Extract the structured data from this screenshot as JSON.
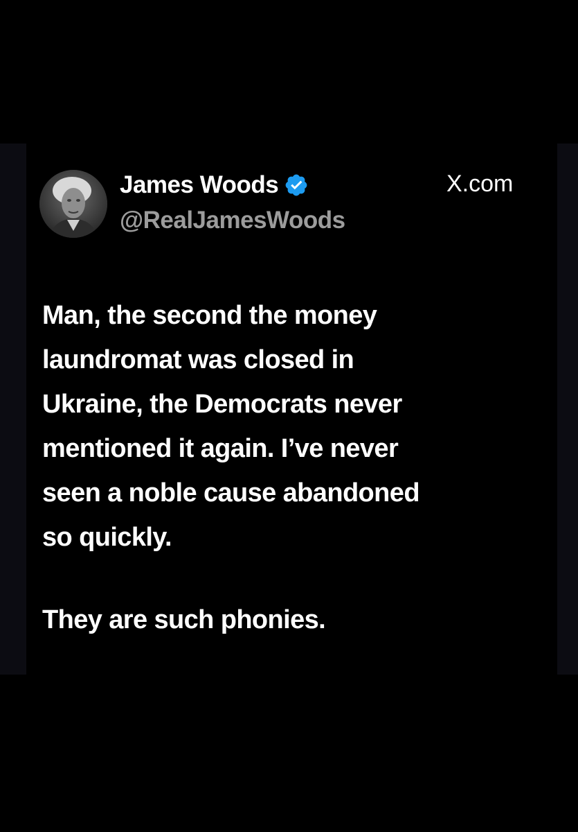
{
  "post": {
    "author_name": "James Woods",
    "author_handle": "@RealJamesWoods",
    "source_site": "X.com",
    "body_lines": [
      "Man, the second the money",
      "laundromat was closed in",
      "Ukraine, the Democrats never",
      "mentioned it again. I’ve never",
      "seen a noble cause abandoned",
      "so quickly."
    ],
    "closing_line": "They are such phonies.",
    "verified": true
  },
  "colors": {
    "background": "#000000",
    "text_primary": "#ffffff",
    "text_secondary": "#9c9c9c",
    "verified_badge": "#1d9bf0"
  },
  "icons": {
    "verified": "verified-badge-icon",
    "avatar": "profile-photo"
  }
}
